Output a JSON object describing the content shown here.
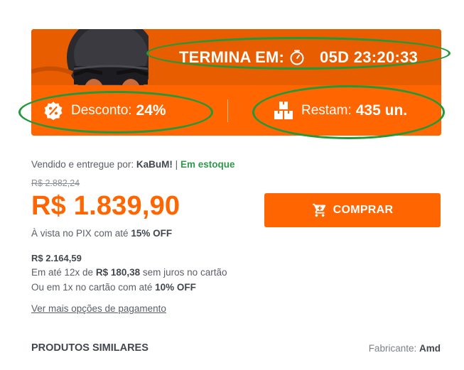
{
  "offer": {
    "ends_label": "TERMINA EM:",
    "countdown": "05D 23:20:33",
    "discount_label": "Desconto:",
    "discount_value": "24%",
    "remaining_label": "Restam:",
    "remaining_value": "435 un."
  },
  "seller": {
    "prefix": "Vendido e entregue por:",
    "name": "KaBuM!",
    "separator": "|",
    "stock": "Em estoque"
  },
  "pricing": {
    "old_price": "R$ 2.882,24",
    "price": "R$ 1.839,90",
    "pix_prefix": "À vista no PIX com até",
    "pix_discount": "15% OFF",
    "card_price": "R$ 2.164,59",
    "installment_prefix": "Em até 12x de",
    "installment_value": "R$ 180,38",
    "installment_suffix": "sem juros no cartão",
    "onetime_prefix": "Ou em 1x no cartão com até",
    "onetime_discount": "10% OFF",
    "more_options": "Ver mais opções de pagamento"
  },
  "buy_button": {
    "label": "COMPRAR",
    "icon": "cart-icon"
  },
  "similar": {
    "title": "PRODUTOS SIMILARES",
    "manufacturer_label": "Fabricante:",
    "manufacturer_value": "Amd"
  },
  "colors": {
    "brand_orange": "#ff6500",
    "banner_dark": "#e85d00",
    "highlight_green": "#1e9a3a",
    "stock_green": "#2e9a4a"
  }
}
